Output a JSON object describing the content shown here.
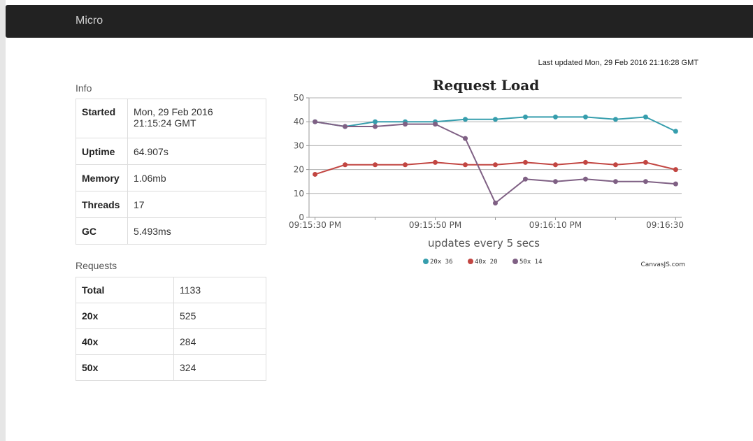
{
  "app": {
    "brand": "Micro"
  },
  "last_updated": "Last updated Mon, 29 Feb 2016 21:16:28 GMT",
  "info": {
    "heading": "Info",
    "rows": [
      {
        "label": "Started",
        "value_line1": "Mon, 29 Feb 2016",
        "value_line2": "21:15:24 GMT"
      },
      {
        "label": "Uptime",
        "value": "64.907s"
      },
      {
        "label": "Memory",
        "value": "1.06mb"
      },
      {
        "label": "Threads",
        "value": "17"
      },
      {
        "label": "GC",
        "value": "5.493ms"
      }
    ]
  },
  "requests": {
    "heading": "Requests",
    "rows": [
      {
        "label": "Total",
        "value": "1133"
      },
      {
        "label": "20x",
        "value": "525"
      },
      {
        "label": "40x",
        "value": "284"
      },
      {
        "label": "50x",
        "value": "324"
      }
    ]
  },
  "chart_data": {
    "type": "line",
    "title": "Request Load",
    "subtitle": "updates every 5 secs",
    "credit": "CanvasJS.com",
    "ylim": [
      0,
      50
    ],
    "yticks": [
      0,
      10,
      20,
      30,
      40,
      50
    ],
    "xticks": [
      "09:15:30 PM",
      "09:15:50 PM",
      "09:16:10 PM",
      "09:16:30"
    ],
    "x_ticks_seconds": [
      30,
      50,
      70,
      90
    ],
    "x_range_seconds": [
      29,
      91
    ],
    "grid": true,
    "legend_position": "bottom",
    "x_seconds": [
      30,
      35,
      40,
      45,
      50,
      55,
      60,
      65,
      70,
      75,
      80,
      85,
      90
    ],
    "series": [
      {
        "name": "20x",
        "color": "#369EAD",
        "last": "36",
        "values": [
          40,
          38,
          40,
          40,
          40,
          41,
          41,
          42,
          42,
          42,
          41,
          42,
          36
        ]
      },
      {
        "name": "40x",
        "color": "#C24642",
        "last": "20",
        "values": [
          18,
          22,
          22,
          22,
          23,
          22,
          22,
          23,
          22,
          23,
          22,
          23,
          20
        ]
      },
      {
        "name": "50x",
        "color": "#7F6084",
        "last": "14",
        "values": [
          40,
          38,
          38,
          39,
          39,
          33,
          6,
          16,
          15,
          16,
          15,
          15,
          14
        ]
      }
    ]
  }
}
